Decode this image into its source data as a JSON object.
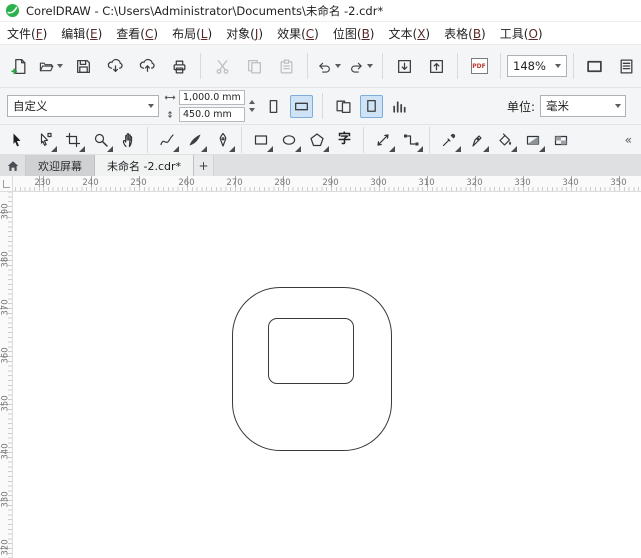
{
  "window": {
    "title": "CorelDRAW - C:\\Users\\Administrator\\Documents\\未命名 -2.cdr*"
  },
  "menu": {
    "items": [
      {
        "text": "文件",
        "key": "F"
      },
      {
        "text": "编辑",
        "key": "E"
      },
      {
        "text": "查看",
        "key": "C"
      },
      {
        "text": "布局",
        "key": "L"
      },
      {
        "text": "对象",
        "key": "J"
      },
      {
        "text": "效果",
        "key": "C"
      },
      {
        "text": "位图",
        "key": "B"
      },
      {
        "text": "文本",
        "key": "X"
      },
      {
        "text": "表格",
        "key": "B"
      },
      {
        "text": "工具",
        "key": "O"
      }
    ]
  },
  "toolbar": {
    "zoom_level": "148%",
    "pdf_label": "PDF"
  },
  "property_bar": {
    "page_preset": "自定义",
    "page_width": "1,000.0 mm",
    "page_height": "450.0 mm",
    "units_label": "单位:",
    "units_value": "毫米"
  },
  "toolbox": {
    "text_tool_glyph": "字",
    "overflow_glyph": "«"
  },
  "tab_bar": {
    "welcome_tab": "欢迎屏幕",
    "document_tab": "未命名 -2.cdr*",
    "new_tab_glyph": "+"
  },
  "rulers": {
    "horizontal": [
      "230",
      "240",
      "250",
      "260",
      "270",
      "280",
      "290",
      "300",
      "310",
      "320",
      "330",
      "340",
      "350"
    ],
    "vertical": [
      "390",
      "380",
      "370",
      "360",
      "350",
      "340",
      "330",
      "320"
    ]
  },
  "colors": {
    "brand_green": "#2bb24c",
    "icon": "#3f3f3f",
    "disabled_icon": "#bcc0c3"
  }
}
